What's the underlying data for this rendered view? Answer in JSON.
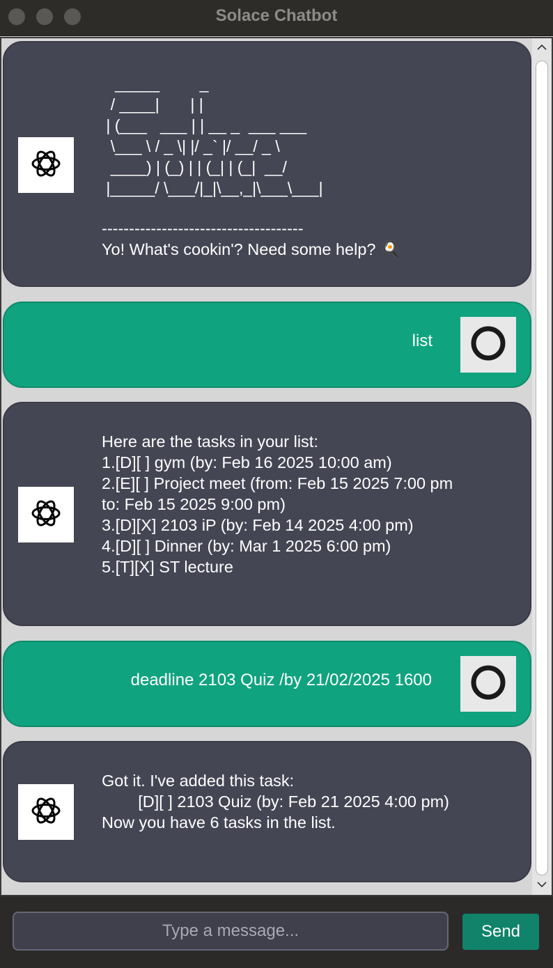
{
  "window": {
    "title": "Solace Chatbot"
  },
  "messages": [
    {
      "sender": "bot",
      "ascii_art": "   _____         _\n  / ____|       | |\n | (___   ___ | | __ _  ___ ___\n  \\___ \\ / _ \\| |/ _` |/ __/ _ \\\n  ____) | (_) | | (_| | (_|  __/\n |_____/ \\___/|_|\\__,_|\\___\\___|",
      "text": "-------------------------------------\nYo! What's cookin'? Need some help? 🍳"
    },
    {
      "sender": "user",
      "text": "list"
    },
    {
      "sender": "bot",
      "text": "Here are the tasks in your list:\n1.[D][ ] gym (by: Feb 16 2025 10:00 am)\n2.[E][ ] Project meet (from: Feb 15 2025 7:00 pm\nto: Feb 15 2025 9:00 pm)\n3.[D][X] 2103 iP (by: Feb 14 2025 4:00 pm)\n4.[D][ ] Dinner (by: Mar 1 2025 6:00 pm)\n5.[T][X] ST lecture"
    },
    {
      "sender": "user",
      "text": "deadline 2103 Quiz /by 21/02/2025 1600"
    },
    {
      "sender": "bot",
      "text": "Got it. I've added this task:\n        [D][ ] 2103 Quiz (by: Feb 21 2025 4:00 pm)\nNow you have 6 tasks in the list."
    }
  ],
  "input": {
    "placeholder": "Type a message...",
    "value": ""
  },
  "send_button": {
    "label": "Send"
  },
  "icons": {
    "bot_avatar": "openai-logo-icon",
    "user_avatar": "ring-icon",
    "scroll_up": "chevron-up-icon",
    "scroll_down": "chevron-down-icon"
  },
  "colors": {
    "bot_bubble": "#454654",
    "user_bubble": "#10a37f",
    "send_button": "#10836a",
    "titlebar": "#2e2c29"
  }
}
